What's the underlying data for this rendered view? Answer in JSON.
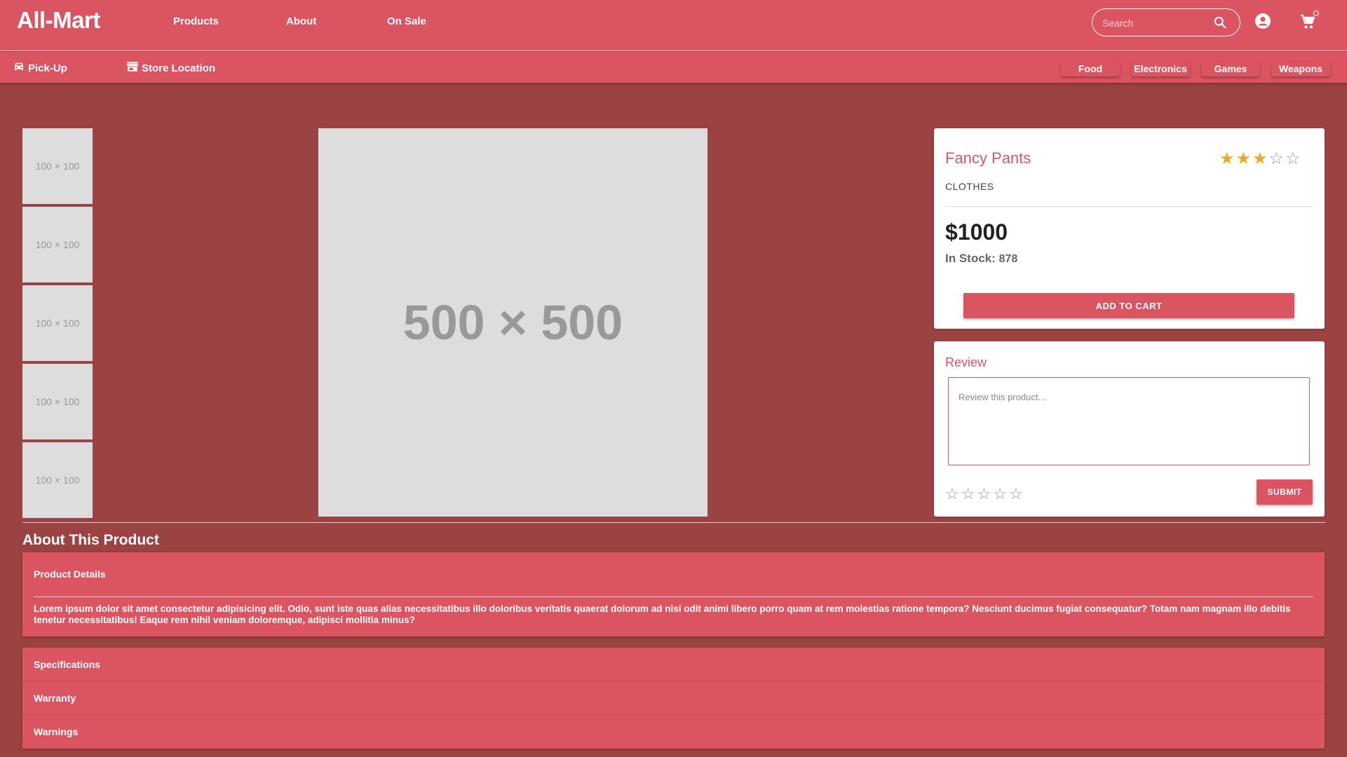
{
  "header": {
    "brand": "All-Mart",
    "nav": [
      "Products",
      "About",
      "On Sale"
    ],
    "search_placeholder": "Search",
    "icons": [
      "search-icon",
      "account-icon",
      "cart-icon"
    ]
  },
  "subnav": {
    "pickup": "Pick-Up",
    "store_location": "Store Location",
    "categories": [
      "Food",
      "Electronics",
      "Games",
      "Weapons"
    ],
    "icons": [
      "car-icon",
      "store-icon"
    ]
  },
  "gallery": {
    "thumbnails": [
      "100 × 100",
      "100 × 100",
      "100 × 100",
      "100 × 100",
      "100 × 100"
    ],
    "main_image": "500 × 500"
  },
  "product": {
    "name": "Fancy Pants",
    "category": "CLOTHES",
    "price": "$1000",
    "stock_label": "In Stock:",
    "stock_value": "878",
    "rating": 3,
    "rating_max": 5,
    "add_to_cart": "ADD TO CART"
  },
  "review": {
    "title": "Review",
    "placeholder": "Review this product...",
    "rating": 0,
    "submit": "SUBMIT"
  },
  "about": {
    "title": "About This Product",
    "details_title": "Product Details",
    "details_text": "Lorem ipsum dolor sit amet consectetur adipisicing elit. Odio, sunt iste quas alias necessitatibus illo doloribus veritatis quaerat dolorum ad nisi odit animi libero porro quam at rem molestias ratione tempora? Nesciunt ducimus fugiat consequatur? Totam nam magnam illo debitis tenetur necessitatibus! Eaque rem nihil veniam doloremque, adipisci mollitia minus?",
    "sections": [
      "Specifications",
      "Warranty",
      "Warnings"
    ]
  },
  "colors": {
    "primary": "#db5462",
    "background": "#9b4242",
    "star_filled": "#f0a81c",
    "star_empty": "#999999"
  }
}
